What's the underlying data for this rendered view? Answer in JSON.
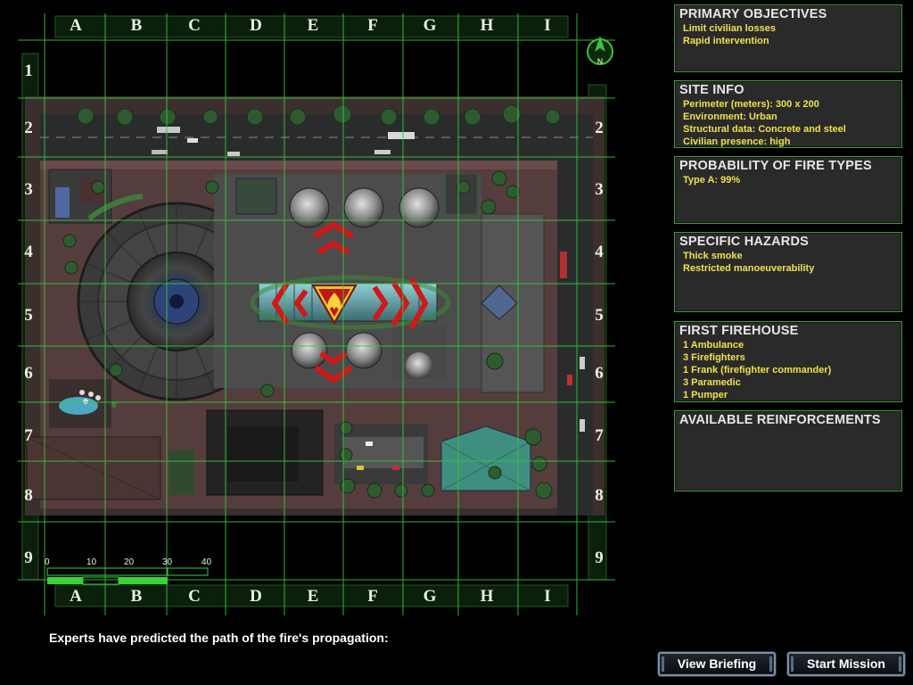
{
  "map": {
    "columns": [
      "A",
      "B",
      "C",
      "D",
      "E",
      "F",
      "G",
      "H",
      "I"
    ],
    "rows": [
      "1",
      "2",
      "3",
      "4",
      "5",
      "6",
      "7",
      "8",
      "9"
    ],
    "scale_labels": [
      "0",
      "10",
      "20",
      "30",
      "40"
    ],
    "compass_label": "N"
  },
  "panels": {
    "primary_objectives": {
      "title": "PRIMARY OBJECTIVES",
      "items": [
        "Limit civilian losses",
        "Rapid intervention"
      ]
    },
    "site_info": {
      "title": "SITE INFO",
      "items": [
        "Perimeter (meters): 300 x 200",
        "Environment: Urban",
        "Structural data: Concrete and steel",
        "Civilian presence: high"
      ]
    },
    "fire_types": {
      "title": "PROBABILITY OF FIRE TYPES",
      "items": [
        "Type A: 99%"
      ]
    },
    "hazards": {
      "title": "SPECIFIC HAZARDS",
      "items": [
        "Thick smoke",
        "Restricted manoeuverability"
      ]
    },
    "firehouse": {
      "title": "FIRST FIREHOUSE",
      "items": [
        "1 Ambulance",
        "3 Firefighters",
        "1 Frank (firefighter commander)",
        "3 Paramedic",
        "1 Pumper"
      ]
    },
    "reinforcements": {
      "title": "AVAILABLE REINFORCEMENTS",
      "items": []
    }
  },
  "caption": "Experts have predicted the path of the fire's propagation:",
  "buttons": {
    "view_briefing": "View Briefing",
    "start_mission": "Start Mission"
  },
  "colors": {
    "grid": "#36c83a",
    "panel_border": "#3f9a3a",
    "item_text": "#f0e24a",
    "arrow": "#d01818"
  }
}
